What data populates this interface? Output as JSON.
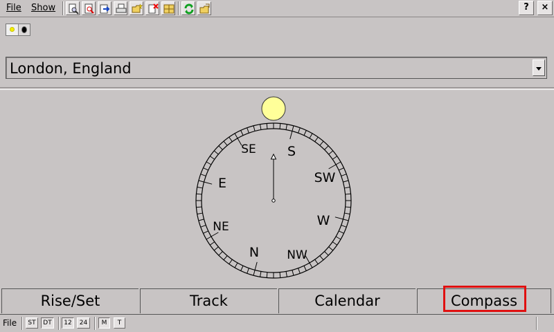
{
  "menu": {
    "file": "File",
    "show": "Show"
  },
  "toolbar": {
    "icons": [
      "find-icon",
      "zoom-icon",
      "go-to-icon",
      "print-icon",
      "new-folder-icon",
      "delete-icon",
      "table-icon",
      "refresh-icon",
      "open-folder-icon"
    ]
  },
  "window_controls": {
    "help": "?",
    "close": "×"
  },
  "daynight_toggle": {
    "selected": "day"
  },
  "location": {
    "value": "London, England"
  },
  "compass": {
    "labels": {
      "S": "S",
      "SW": "SW",
      "W": "W",
      "NW": "NW",
      "N": "N",
      "NE": "NE",
      "E": "E",
      "SE": "SE"
    },
    "sun_color": "#ffff99"
  },
  "tabs": {
    "rise_set": "Rise/Set",
    "track": "Track",
    "calendar": "Calendar",
    "compass": "Compass",
    "selected": "Compass",
    "highlight_color": "#e01010"
  },
  "statusbar": {
    "file": "File",
    "st": "ST",
    "dt": "DT",
    "h12": "12",
    "h24": "24",
    "m": "M",
    "t": "T"
  }
}
